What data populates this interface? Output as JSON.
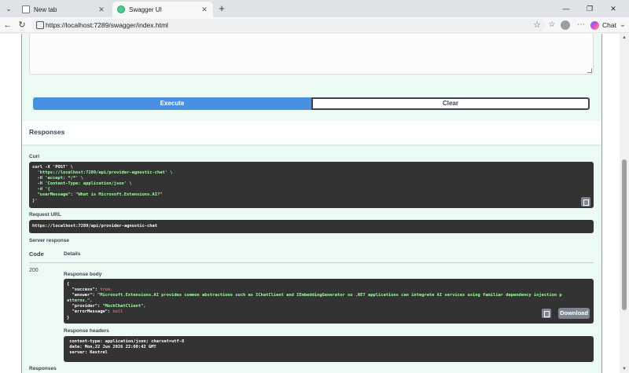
{
  "browser": {
    "tabs": [
      {
        "title": "New tab",
        "favicon": "page-icon"
      },
      {
        "title": "Swagger UI",
        "favicon": "swagger-icon"
      }
    ],
    "new_tab": "+",
    "url": "https://localhost:7289/swagger/index.html",
    "chat_label": "Chat"
  },
  "actions": {
    "execute_label": "Execute",
    "clear_label": "Clear"
  },
  "responses": {
    "title": "Responses",
    "curl_label": "Curl",
    "curl_lines": [
      "curl -X 'POST' \\",
      "  'https://localhost:7289/api/provider-agnostic-chat' \\",
      "  -H 'accept: */*' \\",
      "  -H 'Content-Type: application/json' \\",
      "  -d '{",
      "  \"userMessage\": \"What is Microsoft.Extensions.AI?\"",
      "}'"
    ],
    "request_url_label": "Request URL",
    "request_url": "https://localhost:7289/api/provider-agnostic-chat",
    "server_response_label": "Server response",
    "code_header": "Code",
    "details_header": "Details",
    "status_code": "200",
    "response_body_label": "Response body",
    "body": {
      "open": "{",
      "success_key": "  \"success\": ",
      "success_val": "true,",
      "answer_key": "  \"answer\": ",
      "answer_val_1": "\"Microsoft.Extensions.AI provides common abstractions such as IChatClient and IEmbeddingGenerator so .NET applications can integrate AI services using familiar dependency injection p",
      "answer_val_2": "atterns.\",",
      "provider_key": "  \"provider\": ",
      "provider_val": "\"MockChatClient\",",
      "error_key": "  \"errorMessage\": ",
      "error_val": "null",
      "close": "}"
    },
    "download_label": "Download",
    "response_headers_label": "Response headers",
    "headers_lines": [
      " content-type: application/json; charset=utf-8",
      " date: Mon,22 Jun 2026 22:00:42 GMT",
      " server: Kestrel"
    ],
    "responses_footer": "Responses"
  },
  "colors": {
    "post_green": "#49cc90",
    "execute_blue": "#4990e2",
    "code_bg": "#333333",
    "string_green": "#a2fca2"
  }
}
